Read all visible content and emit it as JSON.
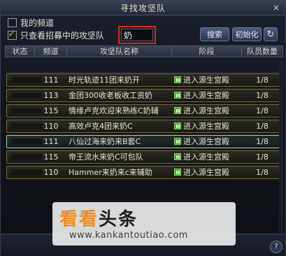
{
  "window": {
    "title": "寻找攻坚队",
    "close_glyph": "×"
  },
  "filters": {
    "my_channel": {
      "label": "我的频道",
      "checked": false
    },
    "recruiting_only": {
      "label": "只查看招募中的攻坚队",
      "checked": true
    }
  },
  "search": {
    "value": "奶",
    "search_label": "搜索",
    "reset_label": "初始化",
    "refresh_glyph": "↻"
  },
  "table": {
    "columns": [
      "状态",
      "频道",
      "攻坚队名称",
      "阶段",
      "队员数量"
    ],
    "rows": [
      {
        "channel": "",
        "name": "",
        "stage": "",
        "members": ""
      },
      {
        "channel": "111",
        "name": "时光轨迹11团来奶开",
        "stage": "进入源生宫殿",
        "members": "1/8"
      },
      {
        "channel": "113",
        "name": "金团300收老板收工资奶",
        "stage": "进入源生宫殿",
        "members": "1/8"
      },
      {
        "channel": "115",
        "name": "情缘卢克欢迎来熟练C奶辅",
        "stage": "进入源生宫殿",
        "members": "1/8"
      },
      {
        "channel": "110",
        "name": "高效卢克4团来奶C",
        "stage": "进入源生宫殿",
        "members": "1/8"
      },
      {
        "channel": "111",
        "name": "八仙过海来奶来B套C",
        "stage": "进入源生宫殿",
        "members": "1/8"
      },
      {
        "channel": "115",
        "name": "帝王流水来奶C可包队",
        "stage": "进入源生宫殿",
        "members": "1/8"
      },
      {
        "channel": "110",
        "name": "Hammer来奶来c来辅助",
        "stage": "进入源生宫殿",
        "members": "1/8"
      }
    ]
  },
  "watermark": {
    "brand_orange": "看看",
    "brand_dark": "头条",
    "url": "www.kankantoutiao.com"
  },
  "colors": {
    "accent_gold": "#e8c060",
    "highlight_red": "#d22a22",
    "selected_border": "#9fd6c4",
    "watermark_orange": "#f28a1e"
  }
}
